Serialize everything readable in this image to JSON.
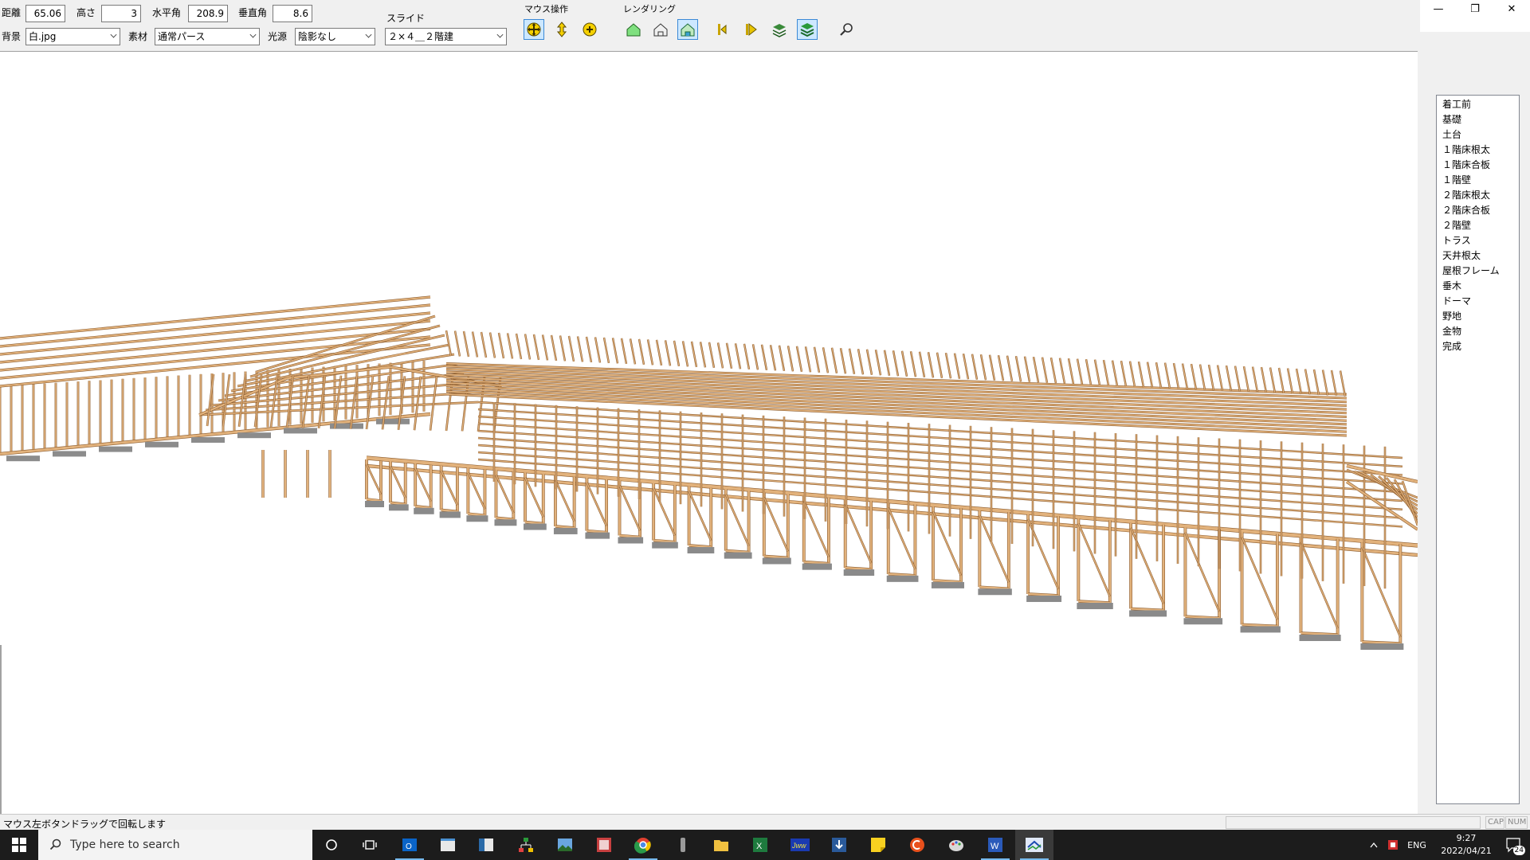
{
  "toolbar": {
    "distance_label": "距離",
    "distance_value": "65.06",
    "height_label": "高さ",
    "height_value": "3",
    "hangle_label": "水平角",
    "hangle_value": "208.9",
    "vangle_label": "垂直角",
    "vangle_value": "8.6",
    "background_label": "背景",
    "background_value": "白.jpg",
    "material_label": "素材",
    "material_value": "通常パース",
    "light_label": "光源",
    "light_value": "陰影なし",
    "slide_label": "スライド",
    "slide_value": "２×４＿２階建",
    "mouse_group_label": "マウス操作",
    "render_group_label": "レンダリング"
  },
  "window": {
    "minimize": "—",
    "restore": "❐",
    "close": "✕"
  },
  "steps": [
    "着工前",
    "基礎",
    "土台",
    "１階床根太",
    "１階床合板",
    "１階壁",
    "２階床根太",
    "２階床合板",
    "２階壁",
    "トラス",
    "天井根太",
    "屋根フレーム",
    "垂木",
    "ドーマ",
    "野地",
    "金物",
    "完成"
  ],
  "status": {
    "message": "マウス左ボタンドラッグで回転します",
    "cap": "CAP",
    "num": "NUM"
  },
  "taskbar": {
    "search_placeholder": "Type here to search",
    "lang": "ENG",
    "time": "9:27",
    "date": "2022/04/21",
    "notification_count": "24"
  },
  "colors": {
    "wood": "#e2b27c",
    "wood_dark": "#8a5a2c",
    "accent": "#0078d7"
  }
}
